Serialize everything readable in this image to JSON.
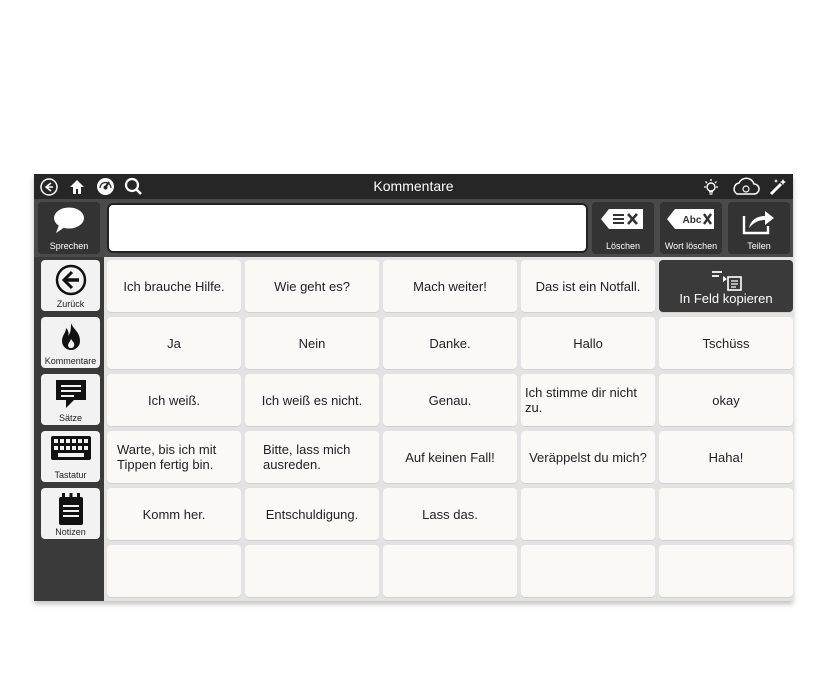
{
  "window": {
    "title": "Kommentare"
  },
  "titlebar_icons": [
    "back-circle-icon",
    "home-icon",
    "speedometer-icon",
    "search-icon",
    "lightbulb-icon",
    "cloud-sync-icon",
    "magic-wand-icon"
  ],
  "toolbar": {
    "speak_label": "Sprechen",
    "message_value": "",
    "clear_label": "Löschen",
    "delete_word_label": "Wort löschen",
    "delete_word_icon_text": "Abc",
    "share_label": "Teilen"
  },
  "sidebar": {
    "items": [
      {
        "label": "Zurück",
        "icon": "arrow-left-circle-icon"
      },
      {
        "label": "Kommentare",
        "icon": "flame-icon"
      },
      {
        "label": "Sätze",
        "icon": "speech-bubble-icon"
      },
      {
        "label": "Tastatur",
        "icon": "keyboard-icon"
      },
      {
        "label": "Notizen",
        "icon": "notepad-icon"
      }
    ]
  },
  "grid": {
    "copy_label": "In Feld kopieren",
    "rows": [
      [
        "Ich brauche Hilfe.",
        "Wie geht es?",
        "Mach weiter!",
        "Das ist ein Notfall."
      ],
      [
        "Ja",
        "Nein",
        "Danke.",
        "Hallo",
        "Tschüss"
      ],
      [
        "Ich weiß.",
        "Ich weiß es nicht.",
        "Genau.",
        "Ich stimme dir nicht zu.",
        "okay"
      ],
      [
        "Warte, bis ich mit Tippen fertig bin.",
        "Bitte, lass mich ausreden.",
        "Auf keinen Fall!",
        "Veräppelst du mich?",
        "Haha!"
      ],
      [
        "Komm her.",
        "Entschuldigung.",
        "Lass das.",
        "",
        ""
      ],
      [
        "",
        "",
        "",
        "",
        ""
      ]
    ]
  },
  "colors": {
    "titlebar": "#262626",
    "toolbar": "#4a4a4a",
    "panel": "#3a3a3a",
    "cell": "#fbf9f6",
    "grid_bg": "#e3e3e3"
  }
}
